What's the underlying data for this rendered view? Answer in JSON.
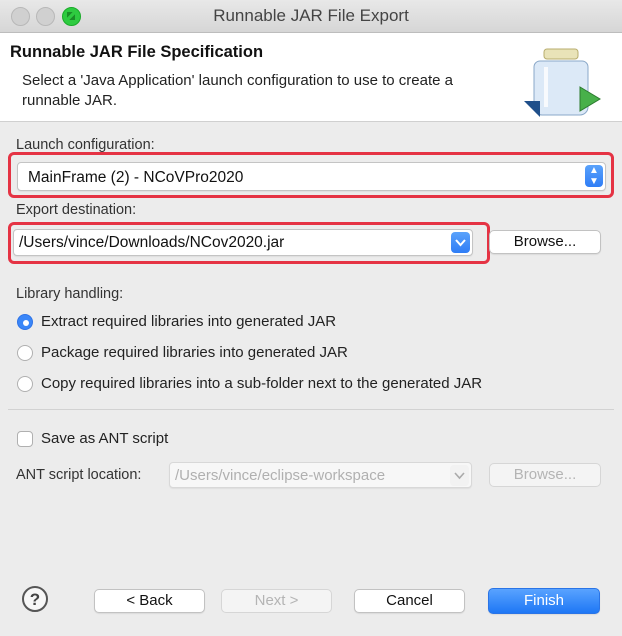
{
  "window": {
    "title": "Runnable JAR File Export"
  },
  "header": {
    "title": "Runnable JAR File Specification",
    "description": "Select a 'Java Application' launch configuration to use to create a runnable JAR."
  },
  "launch": {
    "label": "Launch configuration:",
    "value": "MainFrame (2) - NCoVPro2020"
  },
  "export": {
    "label": "Export destination:",
    "value": "/Users/vince/Downloads/NCov2020.jar",
    "browse": "Browse..."
  },
  "library": {
    "label": "Library handling:",
    "options": [
      {
        "label": "Extract required libraries into generated JAR",
        "selected": true
      },
      {
        "label": "Package required libraries into generated JAR",
        "selected": false
      },
      {
        "label": "Copy required libraries into a sub-folder next to the generated JAR",
        "selected": false
      }
    ]
  },
  "ant": {
    "checkbox_label": "Save as ANT script",
    "checked": false,
    "location_label": "ANT script location:",
    "location_value": "/Users/vince/eclipse-workspace",
    "browse": "Browse..."
  },
  "footer": {
    "help": "?",
    "back": "< Back",
    "next": "Next >",
    "cancel": "Cancel",
    "finish": "Finish"
  },
  "colors": {
    "highlight": "#e53344",
    "accent": "#2f7df6"
  }
}
